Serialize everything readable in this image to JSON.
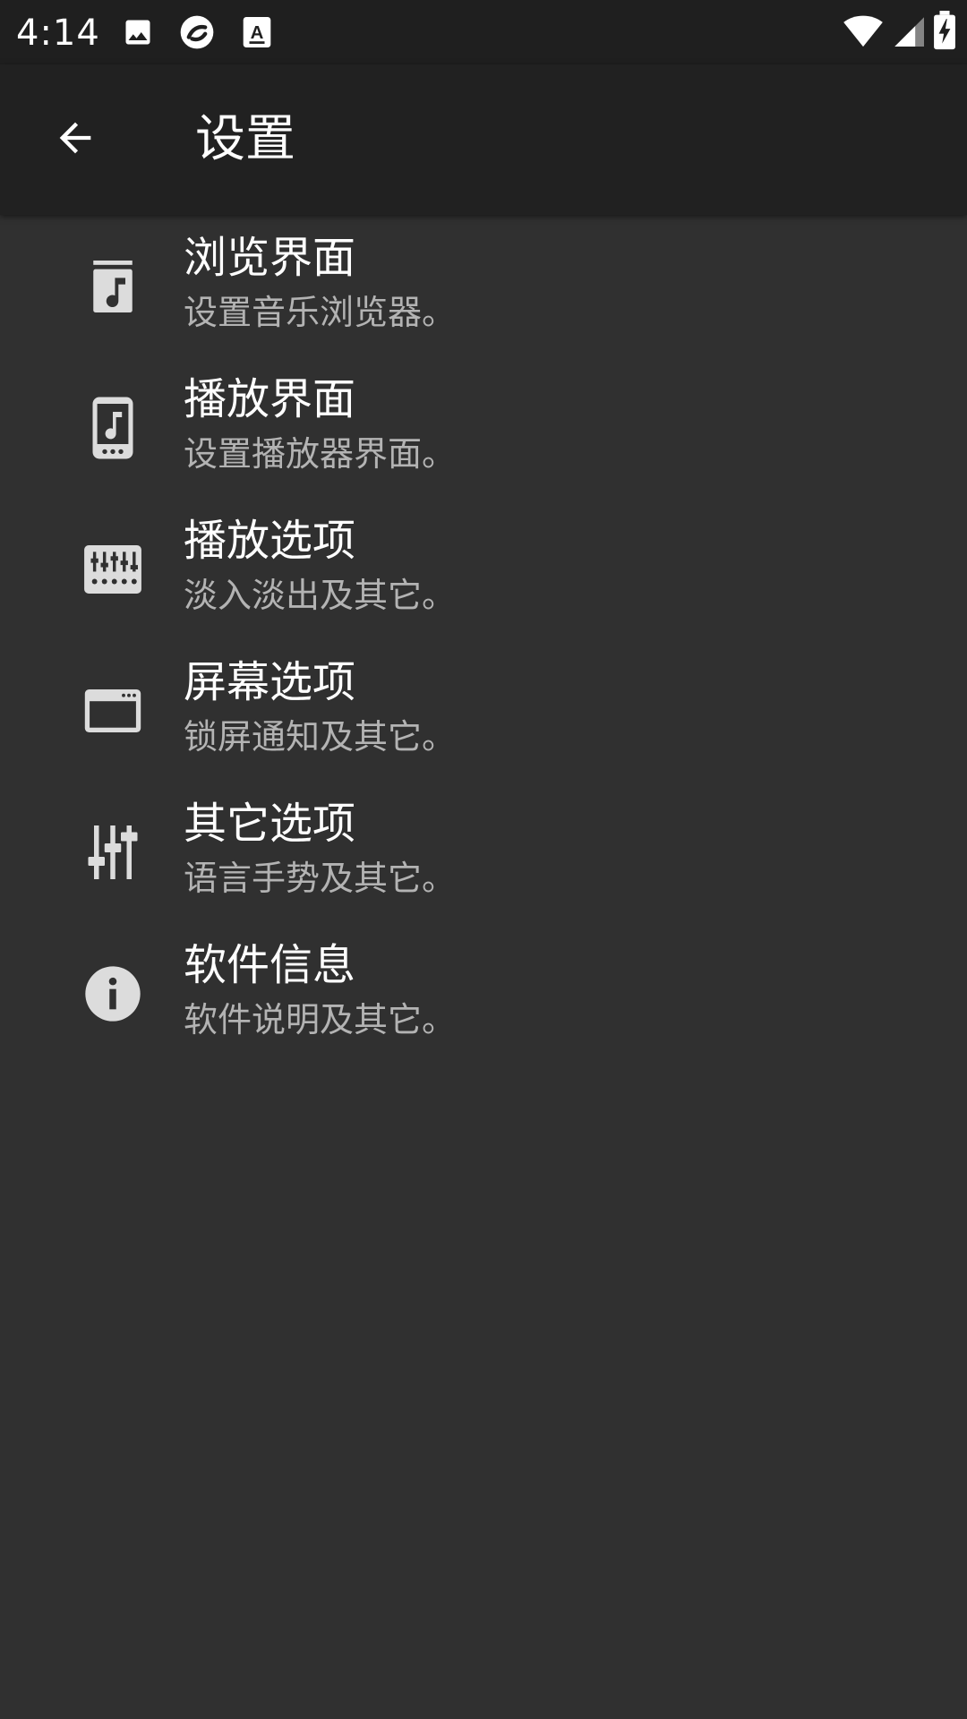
{
  "status_bar": {
    "time": "4:14",
    "notification_icons": [
      "image-icon",
      "sync-app-icon",
      "text-app-icon"
    ],
    "system_icons": [
      "wifi-icon",
      "cell-signal-icon",
      "battery-charging-icon"
    ]
  },
  "app_bar": {
    "title": "设置",
    "back_icon": "arrow-back-icon"
  },
  "colors": {
    "background": "#303030",
    "app_bar": "#212121",
    "status_bar": "#1f1f1f",
    "title_text": "#ffffff",
    "subtitle_text": "#b3b3b3",
    "icon": "#dcdcdc"
  },
  "settings": {
    "items": [
      {
        "title": "浏览界面",
        "subtitle": "设置音乐浏览器。",
        "icon": "music-library-icon"
      },
      {
        "title": "播放界面",
        "subtitle": "设置播放器界面。",
        "icon": "phone-music-icon"
      },
      {
        "title": "播放选项",
        "subtitle": "淡入淡出及其它。",
        "icon": "equalizer-icon"
      },
      {
        "title": "屏幕选项",
        "subtitle": "锁屏通知及其它。",
        "icon": "window-icon"
      },
      {
        "title": "其它选项",
        "subtitle": "语言手势及其它。",
        "icon": "tune-icon"
      },
      {
        "title": "软件信息",
        "subtitle": "软件说明及其它。",
        "icon": "info-icon"
      }
    ]
  }
}
